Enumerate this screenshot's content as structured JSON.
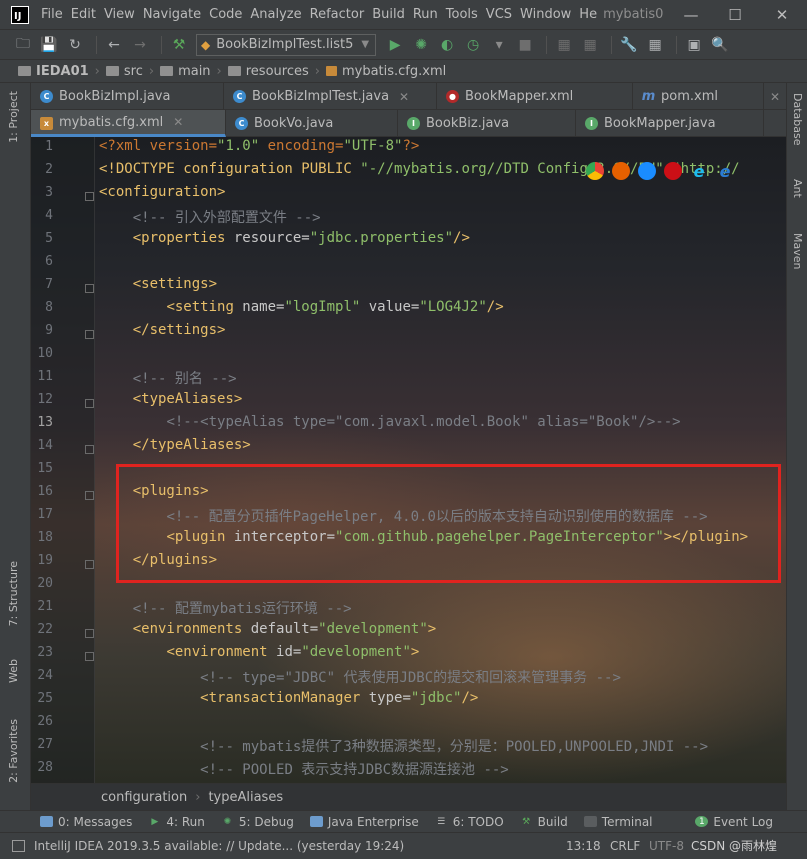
{
  "window": {
    "project_title": "mybatis0",
    "menu": [
      "File",
      "Edit",
      "View",
      "Navigate",
      "Code",
      "Analyze",
      "Refactor",
      "Build",
      "Run",
      "Tools",
      "VCS",
      "Window",
      "He"
    ]
  },
  "toolbar": {
    "run_config": "BookBizImplTest.list5"
  },
  "navbar": {
    "crumbs": [
      "IEDA01",
      "src",
      "main",
      "resources",
      "mybatis.cfg.xml"
    ]
  },
  "tabs": {
    "row1": [
      "BookBizImpl.java",
      "BookBizImplTest.java",
      "BookMapper.xml",
      "pom.xml"
    ],
    "row2": [
      "mybatis.cfg.xml",
      "BookVo.java",
      "BookBiz.java",
      "BookMapper.java"
    ]
  },
  "left_tools": [
    "1: Project",
    "7: Structure",
    "Web",
    "2: Favorites"
  ],
  "right_tools": [
    "Database",
    "Ant",
    "Maven"
  ],
  "editor": {
    "line_numbers": [
      "1",
      "2",
      "3",
      "4",
      "5",
      "6",
      "7",
      "8",
      "9",
      "10",
      "11",
      "12",
      "13",
      "14",
      "15",
      "16",
      "17",
      "18",
      "19",
      "20",
      "21",
      "22",
      "23",
      "24",
      "25",
      "26",
      "27",
      "28"
    ],
    "current_line": "13",
    "lines": [
      {
        "html_key": "l1"
      },
      {
        "html_key": "l2"
      }
    ],
    "text": {
      "l1_a": "<?xml version=",
      "l1_b": "\"1.0\"",
      "l1_c": " encoding=",
      "l1_d": "\"UTF-8\"",
      "l1_e": "?>",
      "l2_a": "<!DOCTYPE configuration PUBLIC ",
      "l2_b": "\"-//mybatis.org//DTD Config 3.0//EN\" \"http://",
      "l3": "<configuration>",
      "l4": "<!-- 引入外部配置文件 -->",
      "l5_a": "<properties ",
      "l5_b": "resource=",
      "l5_c": "\"jdbc.properties\"",
      "l5_d": "/>",
      "l7": "<settings>",
      "l8_a": "<setting ",
      "l8_b": "name=",
      "l8_c": "\"logImpl\"",
      "l8_d": " value=",
      "l8_e": "\"LOG4J2\"",
      "l8_f": "/>",
      "l9": "</settings>",
      "l11": "<!-- 别名 -->",
      "l12": "<typeAliases>",
      "l13": "<!--<typeAlias type=\"com.javaxl.model.Book\" alias=\"Book\"/>-->",
      "l14": "</typeAliases>",
      "l16": "<plugins>",
      "l17": "<!-- 配置分页插件PageHelper, 4.0.0以后的版本支持自动识别使用的数据库 -->",
      "l18_a": "<plugin ",
      "l18_b": "interceptor=",
      "l18_c": "\"com.github.pagehelper.PageInterceptor\"",
      "l18_d": "></plugin>",
      "l19": "</plugins>",
      "l21": "<!-- 配置mybatis运行环境 -->",
      "l22_a": "<environments ",
      "l22_b": "default=",
      "l22_c": "\"development\"",
      "l22_d": ">",
      "l23_a": "<environment ",
      "l23_b": "id=",
      "l23_c": "\"development\"",
      "l23_d": ">",
      "l24": "<!-- type=\"JDBC\" 代表使用JDBC的提交和回滚来管理事务 -->",
      "l25_a": "<transactionManager ",
      "l25_b": "type=",
      "l25_c": "\"jdbc\"",
      "l25_d": "/>",
      "l27": "<!-- mybatis提供了3种数据源类型，分别是：POOLED,UNPOOLED,JNDI -->",
      "l28": "<!-- POOLED 表示支持JDBC数据源连接池 -->"
    }
  },
  "editor_breadcrumb": [
    "configuration",
    "typeAliases"
  ],
  "bottom_tools": [
    "0: Messages",
    "4: Run",
    "5: Debug",
    "Java Enterprise",
    "6: TODO",
    "Build",
    "Terminal",
    "Event Log"
  ],
  "status": {
    "message": "IntelliJ IDEA 2019.3.5 available: // Update... (yesterday 19:24)",
    "position": "13:18",
    "line_sep": "CRLF",
    "encoding": "UTF-8",
    "watermark": "CSDN @雨林煌"
  },
  "colors": {
    "highlight_box": "#e0231f",
    "active_tab_underline": "#4a88c7"
  }
}
